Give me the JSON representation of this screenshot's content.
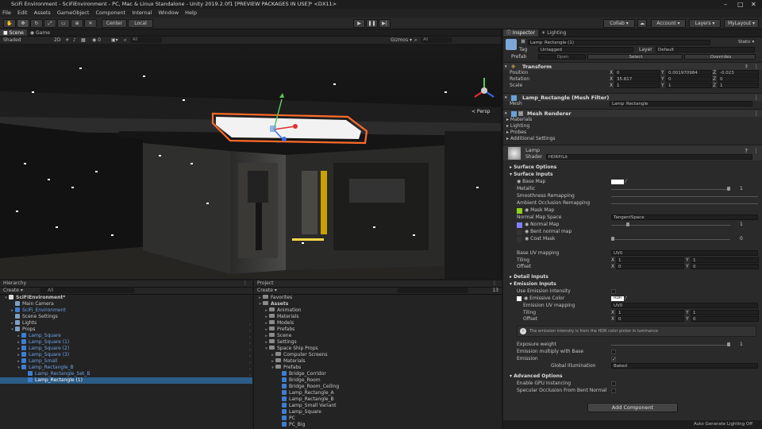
{
  "window": {
    "title": "SciFi Environment - SciFiEnvironment - PC, Mac & Linux Standalone - Unity 2019.2.0f1 [PREVIEW PACKAGES IN USE]* <DX11>"
  },
  "menu": [
    "File",
    "Edit",
    "Assets",
    "GameObject",
    "Component",
    "Internal",
    "Window",
    "Help"
  ],
  "toolbar": {
    "pivot": "Center",
    "space": "Local",
    "collab": "Collab ▾",
    "account": "Account ▾",
    "layers": "Layers ▾",
    "layout": "MyLayout ▾"
  },
  "scene": {
    "tabs": [
      "Scene",
      "Game"
    ],
    "shading": "Shaded",
    "mode2d": "2D",
    "gizmos": "Gizmos ▾",
    "search": "All",
    "persp": "< Persp"
  },
  "hierarchy": {
    "tab": "Hierarchy",
    "create": "Create ▾",
    "search": "All",
    "items": [
      {
        "label": "SciFiEnvironment*",
        "indent": 0,
        "tri": "▾",
        "style": "scene"
      },
      {
        "label": "Main Camera",
        "indent": 1,
        "tri": "",
        "style": "obj"
      },
      {
        "label": "SciFi_Environment",
        "indent": 1,
        "tri": "▸",
        "style": "prefab"
      },
      {
        "label": "Scene Settings",
        "indent": 1,
        "tri": "",
        "style": "obj"
      },
      {
        "label": "Lights",
        "indent": 1,
        "tri": "▸",
        "style": "obj"
      },
      {
        "label": "Props",
        "indent": 1,
        "tri": "▾",
        "style": "obj"
      },
      {
        "label": "Lamp_Square",
        "indent": 2,
        "tri": "▸",
        "style": "prefab"
      },
      {
        "label": "Lamp_Square (1)",
        "indent": 2,
        "tri": "▸",
        "style": "prefab"
      },
      {
        "label": "Lamp_Square (2)",
        "indent": 2,
        "tri": "▸",
        "style": "prefab"
      },
      {
        "label": "Lamp_Square (3)",
        "indent": 2,
        "tri": "▸",
        "style": "prefab"
      },
      {
        "label": "Lamp_Small",
        "indent": 2,
        "tri": "▸",
        "style": "prefab"
      },
      {
        "label": "Lamp_Rectangle_B",
        "indent": 2,
        "tri": "▾",
        "style": "prefab"
      },
      {
        "label": "Lamp_Rectangle_Set_B",
        "indent": 3,
        "tri": "",
        "style": "prefab"
      },
      {
        "label": "Lamp_Rectangle (1)",
        "indent": 3,
        "tri": "",
        "style": "selected"
      }
    ]
  },
  "project": {
    "tab": "Project",
    "create": "Create ▾",
    "count": "13",
    "items": [
      {
        "label": "Favorites",
        "indent": 0,
        "tri": "▸",
        "type": "folder"
      },
      {
        "label": "Assets",
        "indent": 0,
        "tri": "▾",
        "type": "folder",
        "bold": true
      },
      {
        "label": "Animation",
        "indent": 1,
        "tri": "▸",
        "type": "folder"
      },
      {
        "label": "Materials",
        "indent": 1,
        "tri": "▸",
        "type": "folder"
      },
      {
        "label": "Models",
        "indent": 1,
        "tri": "▸",
        "type": "folder"
      },
      {
        "label": "Prefabs",
        "indent": 1,
        "tri": "▸",
        "type": "folder"
      },
      {
        "label": "Scene",
        "indent": 1,
        "tri": "▸",
        "type": "folder"
      },
      {
        "label": "Settings",
        "indent": 1,
        "tri": "▸",
        "type": "folder"
      },
      {
        "label": "Space Ship Props",
        "indent": 1,
        "tri": "▾",
        "type": "folder"
      },
      {
        "label": "Computer Screens",
        "indent": 2,
        "tri": "▸",
        "type": "folder"
      },
      {
        "label": "Materials",
        "indent": 2,
        "tri": "▸",
        "type": "folder"
      },
      {
        "label": "Prefabs",
        "indent": 2,
        "tri": "▾",
        "type": "folder"
      },
      {
        "label": "Bridge_Corridor",
        "indent": 3,
        "tri": "",
        "type": "prefab"
      },
      {
        "label": "Bridge_Room",
        "indent": 3,
        "tri": "",
        "type": "prefab"
      },
      {
        "label": "Bridge_Room_Ceiling",
        "indent": 3,
        "tri": "",
        "type": "prefab"
      },
      {
        "label": "Lamp_Rectangle_A",
        "indent": 3,
        "tri": "",
        "type": "prefab"
      },
      {
        "label": "Lamp_Rectangle_B",
        "indent": 3,
        "tri": "",
        "type": "prefab"
      },
      {
        "label": "Lamp_Small Variant",
        "indent": 3,
        "tri": "",
        "type": "prefab"
      },
      {
        "label": "Lamp_Square",
        "indent": 3,
        "tri": "",
        "type": "prefab"
      },
      {
        "label": "PC",
        "indent": 3,
        "tri": "",
        "type": "prefab"
      },
      {
        "label": "PC_Big",
        "indent": 3,
        "tri": "",
        "type": "prefab"
      }
    ]
  },
  "inspector": {
    "tabs": [
      "Inspector",
      "Lighting"
    ],
    "object": {
      "name": "Lamp_Rectangle (1)",
      "static": "Static ▾",
      "tag_label": "Tag",
      "tag": "Untagged",
      "layer_label": "Layer",
      "layer": "Default",
      "prefab_label": "Prefab",
      "open": "Open",
      "select": "Select",
      "overrides": "Overrides"
    },
    "transform": {
      "title": "Transform",
      "rows": [
        {
          "label": "Position",
          "x": "0",
          "y": "0.001970984",
          "z": "-0.023"
        },
        {
          "label": "Rotation",
          "x": "35.817",
          "y": "0",
          "z": "0"
        },
        {
          "label": "Scale",
          "x": "1",
          "y": "1",
          "z": "1"
        }
      ]
    },
    "meshfilter": {
      "title": "Lamp_Rectangle (Mesh Filter)",
      "mesh_label": "Mesh",
      "mesh": "Lamp_Rectangle"
    },
    "meshrenderer": {
      "title": "Mesh Renderer",
      "items": [
        "Materials",
        "Lighting",
        "Probes",
        "Additional Settings"
      ]
    },
    "material": {
      "name": "Lamp",
      "shader_label": "Shader",
      "shader": "HDRP/Lit"
    },
    "surface_options": "Surface Options",
    "surface_inputs": "Surface Inputs",
    "base_map": "Base Map",
    "metallic": "Metallic",
    "metallic_val": "1",
    "smoothness": "Smoothness Remapping",
    "ao": "Ambient Occlusion Remapping",
    "mask_map": "Mask Map",
    "normal_space": "Normal Map Space",
    "normal_space_val": "TangentSpace",
    "normal_map": "Normal Map",
    "normal_val": "1",
    "bent_normal": "Bent normal map",
    "coat_mask": "Coat Mask",
    "coat_val": "0",
    "base_uv": "Base UV mapping",
    "base_uv_val": "UV0",
    "tiling": "Tiling",
    "offset": "Offset",
    "tiling_x": "1",
    "tiling_y": "1",
    "offset_x": "0",
    "offset_y": "0",
    "detail_inputs": "Detail Inputs",
    "emission_inputs": "Emission Inputs",
    "use_emission_intensity": "Use Emission Intensity",
    "emissive_color": "Emissive Color",
    "hdr": "HDR",
    "emission_uv": "Emission UV mapping",
    "emission_uv_val": "UV0",
    "info": "The emission intensity is from the HDR color picker in luminance",
    "exposure_weight": "Exposure weight",
    "exposure_val": "1",
    "emission_multiply": "Emission multiply with Base",
    "emission": "Emission",
    "global_illum": "Global Illumination",
    "global_illum_val": "Baked",
    "advanced_options": "Advanced Options",
    "gpu_instancing": "Enable GPU Instancing",
    "specular_occlusion": "Specular Occlusion From Bent Normal",
    "add_component": "Add Component"
  },
  "status": "Auto Generate Lighting Off",
  "colors": {
    "accent": "#2c5d87",
    "prefab_text": "#6fa3e6",
    "highlight": "#ff6a2a"
  }
}
